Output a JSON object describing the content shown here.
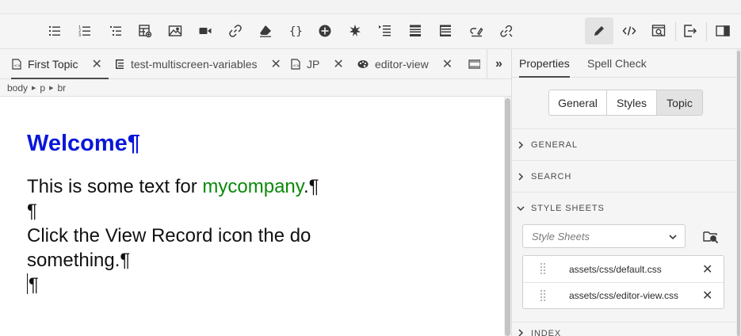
{
  "toolbar": {
    "buttons": [
      {
        "icon": "bulleted-list-icon"
      },
      {
        "icon": "numbered-list-icon"
      },
      {
        "icon": "multilevel-list-icon"
      },
      {
        "icon": "insert-table-icon"
      },
      {
        "icon": "insert-image-icon"
      },
      {
        "icon": "insert-video-icon"
      },
      {
        "icon": "insert-link-icon"
      },
      {
        "icon": "eraser-icon"
      },
      {
        "icon": "code-braces-icon"
      },
      {
        "icon": "add-circle-icon"
      },
      {
        "icon": "asterisk-icon"
      },
      {
        "icon": "list-indent-icon"
      },
      {
        "icon": "element-block-icon"
      },
      {
        "icon": "table-layout-icon"
      },
      {
        "icon": "link-edit-icon"
      },
      {
        "icon": "unlink-icon"
      },
      {
        "icon": "pencil-author-icon"
      },
      {
        "icon": "source-code-icon"
      },
      {
        "icon": "preview-icon"
      },
      {
        "icon": "export-icon"
      },
      {
        "icon": "toggle-panel-icon"
      }
    ]
  },
  "tabs": [
    {
      "label": "First Topic",
      "icon": "topic-file-icon",
      "active": true
    },
    {
      "label": "test-multiscreen-variables",
      "icon": "map-file-icon",
      "active": false
    },
    {
      "label": "JP",
      "icon": "topic-file-icon",
      "active": false
    },
    {
      "label": "editor-view",
      "icon": "palette-icon",
      "active": false
    }
  ],
  "tabs_more_label": "»",
  "breadcrumb": [
    "body",
    "p",
    "br"
  ],
  "editor": {
    "heading": "Welcome¶",
    "line1_before": "This is some text for ",
    "line1_link": "mycompany",
    "line1_after": ".¶",
    "pilcrow": "¶",
    "line3": "Click the     View Record icon the do something.¶",
    "line4": "¶"
  },
  "panel": {
    "tabs": [
      {
        "label": "Properties",
        "active": true
      },
      {
        "label": "Spell Check",
        "active": false
      }
    ],
    "segments": [
      {
        "label": "General",
        "active": false
      },
      {
        "label": "Styles",
        "active": false
      },
      {
        "label": "Topic",
        "active": true
      }
    ],
    "sections": {
      "general": "GENERAL",
      "search": "SEARCH",
      "style_sheets": "STYLE SHEETS",
      "index": "INDEX"
    },
    "stylesheet_select_placeholder": "Style Sheets",
    "stylesheets": [
      "assets/css/default.css",
      "assets/css/editor-view.css"
    ]
  }
}
